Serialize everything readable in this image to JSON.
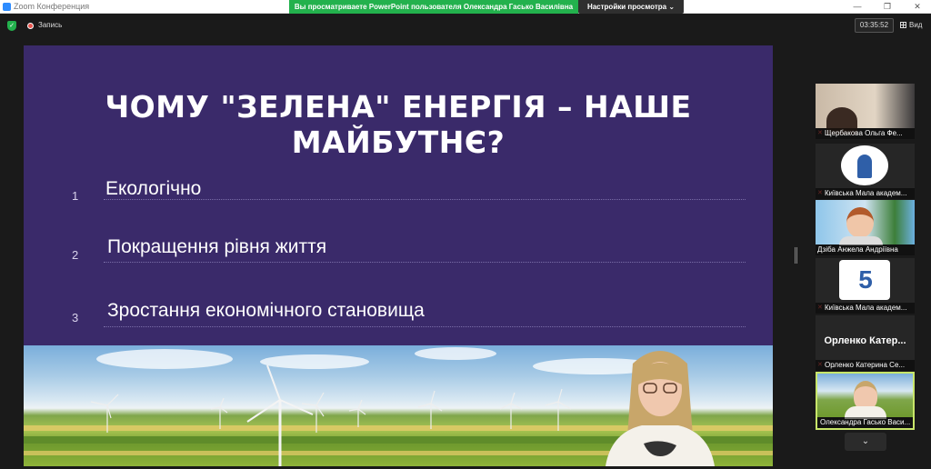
{
  "window": {
    "title": "Zoom Конференция",
    "share_banner": "Вы просматриваете PowerPoint пользователя Олександра Гасько Василівна",
    "view_options": "Настройки просмотра",
    "minimize": "—",
    "maximize": "❐",
    "close": "✕"
  },
  "toolbar": {
    "record_label": "Запись",
    "timer": "03:35:52",
    "view_label": "Вид"
  },
  "slide": {
    "title": "ЧОМУ \"ЗЕЛЕНА\" ЕНЕРГІЯ – НАШЕ МАЙБУТНЄ?",
    "items": [
      {
        "num": "1",
        "text": "Екологічно"
      },
      {
        "num": "2",
        "text": "Покращення рівня життя"
      },
      {
        "num": "3",
        "text": "Зростання економічного становища"
      }
    ]
  },
  "participants": [
    {
      "name": "Щербакова Ольга Фе..."
    },
    {
      "name": "Київська Мала академ..."
    },
    {
      "name": "Дзіба Анжела Андріївна"
    },
    {
      "name": "Київська Мала академ..."
    },
    {
      "name": "Орленко Катерина Се...",
      "display": "Орленко  Катер..."
    },
    {
      "name": "Олександра Гасько Васи..."
    }
  ],
  "side_panel": {
    "scroll_down": "⌄"
  },
  "colors": {
    "slide_bg": "#3a2a6a",
    "share_banner": "#23b14d",
    "active_speaker_border": "#c8e66a"
  }
}
